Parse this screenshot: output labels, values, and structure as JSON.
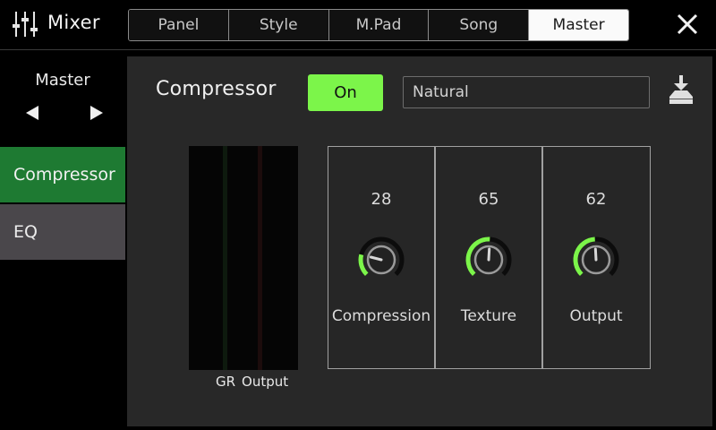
{
  "header": {
    "title": "Mixer",
    "icon": "mixer-sliders-icon",
    "tabs": [
      {
        "label": "Panel",
        "active": false
      },
      {
        "label": "Style",
        "active": false
      },
      {
        "label": "M.Pad",
        "active": false
      },
      {
        "label": "Song",
        "active": false
      },
      {
        "label": "Master",
        "active": true
      }
    ],
    "close_icon": "close-icon"
  },
  "sidebar": {
    "title": "Master",
    "prev_icon": "arrow-left-icon",
    "next_icon": "arrow-right-icon",
    "items": [
      {
        "label": "Compressor",
        "active": true
      },
      {
        "label": "EQ",
        "active": false
      }
    ]
  },
  "compressor": {
    "title": "Compressor",
    "on_label": "On",
    "preset": "Natural",
    "save_icon": "save-download-icon",
    "meter_label_gr": "GR",
    "meter_label_output": "Output",
    "knobs": [
      {
        "label": "Compression",
        "value": 28
      },
      {
        "label": "Texture",
        "value": 65
      },
      {
        "label": "Output",
        "value": 62
      }
    ]
  },
  "colors": {
    "accent_green": "#7cf54a",
    "sidebar_active": "#1e7a32",
    "sidebar_inactive": "#4a474b",
    "panel_bg": "#282828"
  }
}
